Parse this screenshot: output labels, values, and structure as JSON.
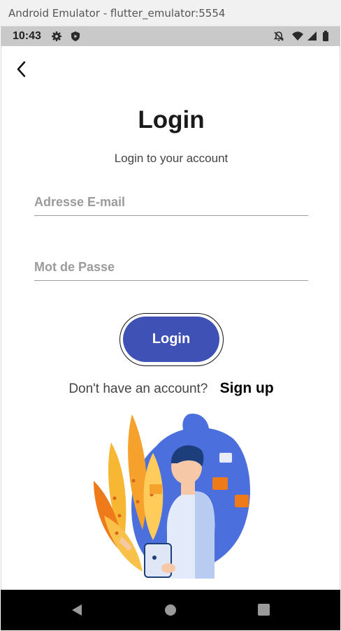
{
  "window": {
    "title": "Android Emulator - flutter_emulator:5554"
  },
  "status_bar": {
    "time": "10:43",
    "left_icons": [
      "gear-icon",
      "shield-play-icon"
    ],
    "right_icons": [
      "notifications-off-icon",
      "wifi-icon",
      "signal-icon",
      "battery-icon"
    ]
  },
  "page": {
    "back_icon": "chevron-left-icon",
    "title": "Login",
    "subtitle": "Login to your account",
    "email_placeholder": "Adresse E-mail",
    "password_placeholder": "Mot de Passe",
    "login_label": "Login",
    "signup_prompt": "Don't have an account?",
    "signup_link": "Sign up"
  },
  "nav_bar": {
    "buttons": [
      "back-triangle-icon",
      "home-circle-icon",
      "recents-square-icon"
    ]
  },
  "colors": {
    "primary": "#3f51b5",
    "nav_bar": "#000000",
    "status_bar": "#c9c9c9",
    "illustration_blue": "#4b6fdc",
    "illustration_orange": "#f5a12b"
  }
}
